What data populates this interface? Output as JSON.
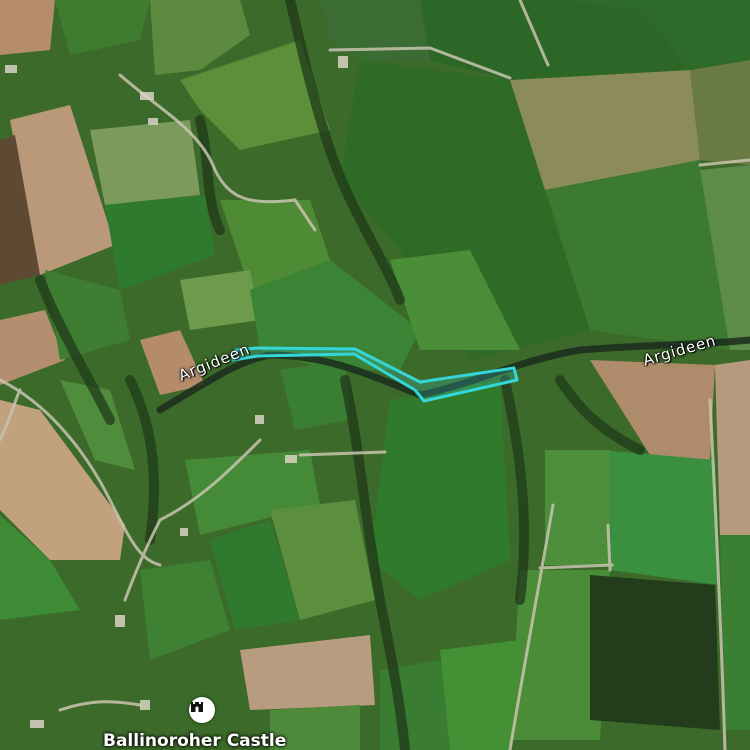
{
  "map": {
    "type": "satellite",
    "labels": {
      "river_left": "Argideen",
      "river_right": "Argideen",
      "poi": "Ballinoroher Castle"
    },
    "poi_icon": "castle-icon",
    "colors": {
      "highlight": "#35d6d9",
      "river": "#1f3524",
      "field_green": "#4f8a34",
      "field_brown": "#b9997a",
      "label_text": "#ffffff"
    }
  }
}
